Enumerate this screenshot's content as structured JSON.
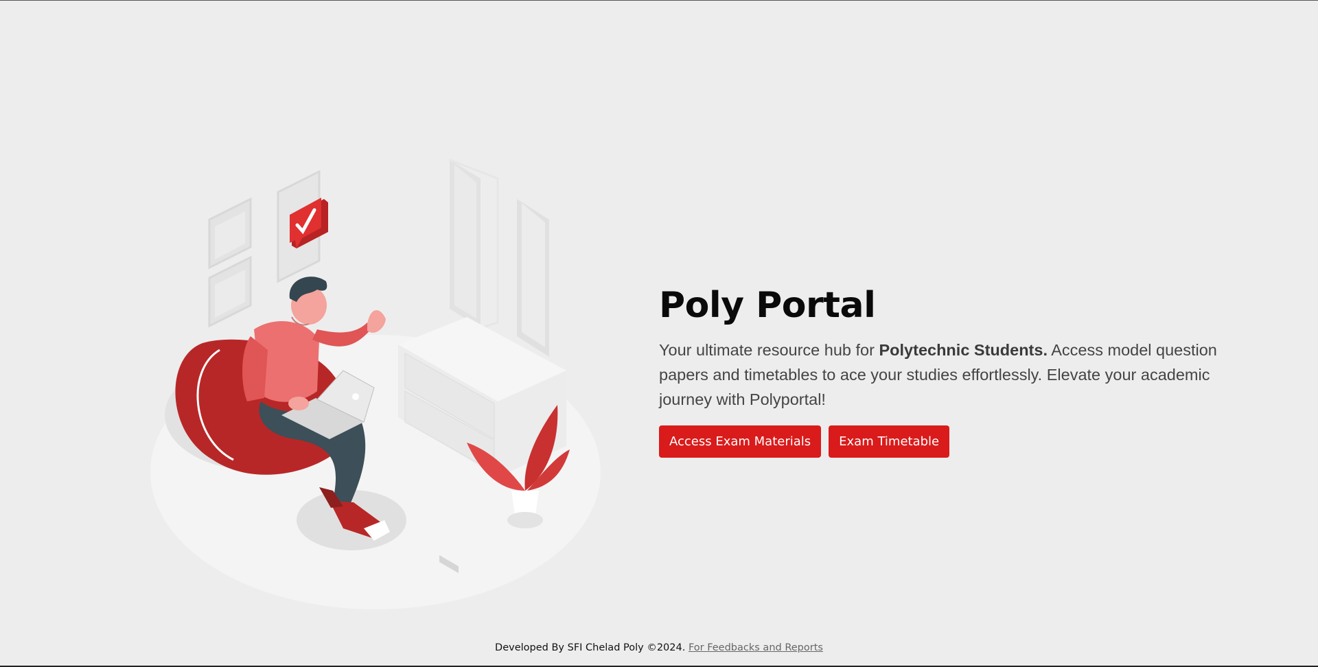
{
  "hero": {
    "title": "Poly Portal",
    "description_prefix": "Your ultimate resource hub for ",
    "description_bold": "Polytechnic Students.",
    "description_suffix": " Access model question papers and timetables to ace your studies effortlessly. Elevate your academic journey with Polyportal!",
    "buttons": [
      {
        "label": "Access Exam Materials"
      },
      {
        "label": "Exam Timetable"
      }
    ]
  },
  "illustration": {
    "icon": "student-with-laptop-illustration"
  },
  "footer": {
    "credit": "Developed By SFI Chelad Poly ©2024. ",
    "link": "For Feedbacks and Reports"
  },
  "colors": {
    "accent": "#d91b1b",
    "background": "#eeeded"
  }
}
